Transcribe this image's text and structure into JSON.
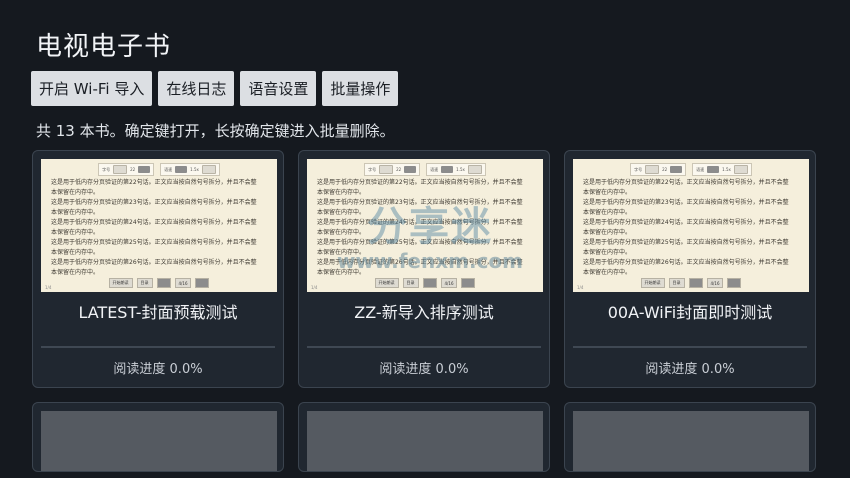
{
  "app": {
    "title": "电视电子书"
  },
  "toolbar": {
    "wifi_import": "开启 Wi-Fi 导入",
    "online_log": "在线日志",
    "voice_settings": "语音设置",
    "batch_ops": "批量操作"
  },
  "hint": "共 13 本书。确定键打开，长按确定键进入批量删除。",
  "preview": {
    "chapter_label": "字号",
    "chapter_value": "22",
    "speed_label": "语速",
    "speed_value": "1.5x",
    "lines": [
      "这是用于低内存分页验证的第22句话。正文应当按自然句号拆分，并且不会整",
      "本保留在内存中。",
      "这是用于低内存分页验证的第23句话。正文应当按自然句号拆分，并且不会整",
      "本保留在内存中。",
      "这是用于低内存分页验证的第24句话。正文应当按自然句号拆分，并且不会整",
      "本保留在内存中。",
      "这是用于低内存分页验证的第25句话。正文应当按自然句号拆分，并且不会整",
      "本保留在内存中。",
      "这是用于低内存分页验证的第26句话。正文应当按自然句号拆分，并且不会整",
      "本保留在内存中。"
    ],
    "bottom_chip1": "开始朗读",
    "bottom_chip2": "目录",
    "bottom_chip3": "4/16",
    "corner": "1/4"
  },
  "books": [
    {
      "title": "LATEST-封面预载测试",
      "progress": "阅读进度 0.0%"
    },
    {
      "title": "ZZ-新导入排序测试",
      "progress": "阅读进度 0.0%"
    },
    {
      "title": "00A-WiFi封面即时测试",
      "progress": "阅读进度 0.0%"
    }
  ],
  "watermark": {
    "cn": "分享迷",
    "url": "www.fenxm.com"
  }
}
